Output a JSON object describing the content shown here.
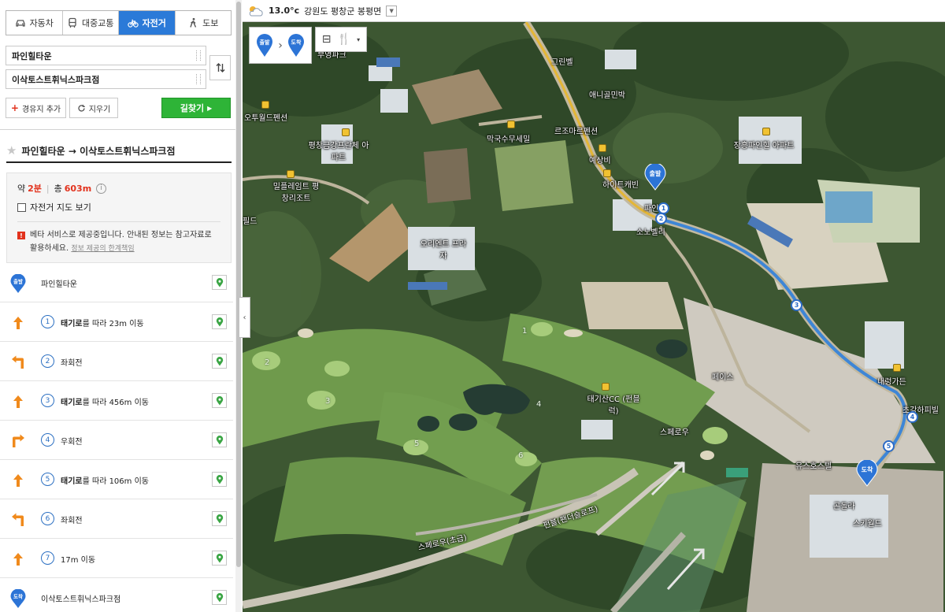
{
  "modes": {
    "car": "자동차",
    "transit": "대중교통",
    "bike": "자전거",
    "walk": "도보",
    "active": "bike"
  },
  "route_inputs": {
    "start": "파인힐타운",
    "end": "이삭토스트휘닉스파크점"
  },
  "buttons": {
    "add_waypoint": "경유지 추가",
    "clear": "지우기",
    "search": "길찾기"
  },
  "route": {
    "title": "파인힐타운 → 이삭토스트휘닉스파크점",
    "approx_label": "약",
    "time": "2분",
    "total_label": "총",
    "distance": "603m",
    "bike_map_label": "자전거 지도 보기",
    "beta_notice": "베타 서비스로 제공중입니다. 안내된 정보는 참고자료로 활용하세요.",
    "beta_link": "정보 제공의 한계책임"
  },
  "steps": [
    {
      "type": "start",
      "badge": "출발",
      "text": "파인힐타운"
    },
    {
      "type": "straight",
      "num": "1",
      "bold": "태기로",
      "rest": "를 따라 23m 이동"
    },
    {
      "type": "left",
      "num": "2",
      "bold": "",
      "rest": "좌회전"
    },
    {
      "type": "straight",
      "num": "3",
      "bold": "태기로",
      "rest": "를 따라 456m 이동"
    },
    {
      "type": "right",
      "num": "4",
      "bold": "",
      "rest": "우회전"
    },
    {
      "type": "straight",
      "num": "5",
      "bold": "태기로",
      "rest": "를 따라 106m 이동"
    },
    {
      "type": "left",
      "num": "6",
      "bold": "",
      "rest": "좌회전"
    },
    {
      "type": "straight",
      "num": "7",
      "bold": "",
      "rest": "17m 이동"
    },
    {
      "type": "end",
      "badge": "도착",
      "text": "이삭토스트휘닉스파크점"
    }
  ],
  "weather": {
    "icon": "partly-cloudy-icon",
    "temp": "13.0°c",
    "location": "강원도 평창군 봉평면"
  },
  "map": {
    "start_badge": "출발",
    "end_badge": "도착",
    "route_numbers": [
      "1",
      "2",
      "3",
      "4",
      "5"
    ],
    "labels": [
      "부영파크",
      "그린벨",
      "애니골민박",
      "르조마르펜션",
      "막국수무세밀",
      "오투월드펜션",
      "평창금강프란체 아파트",
      "밀플레임트 평창리조트",
      "오리엔트 프라자",
      "하이트캐빈",
      "파인",
      "소노벨리",
      "장흥파인힐 아파트",
      "예상비",
      "태기산CC (펀블럭)",
      "스페로우",
      "내렁가든",
      "초강하피빌",
      "유스호스텔",
      "곤돌라",
      "스키월드",
      "페이스",
      "스페로우(초급)",
      "펀블(팬더슬로프)",
      "필드"
    ],
    "holes": [
      "1",
      "2",
      "3",
      "4",
      "5",
      "6"
    ]
  },
  "colors": {
    "accent": "#2b7ad8",
    "search_green": "#2eb437",
    "red": "#e2321d",
    "route_blue": "#2c6bc6"
  }
}
